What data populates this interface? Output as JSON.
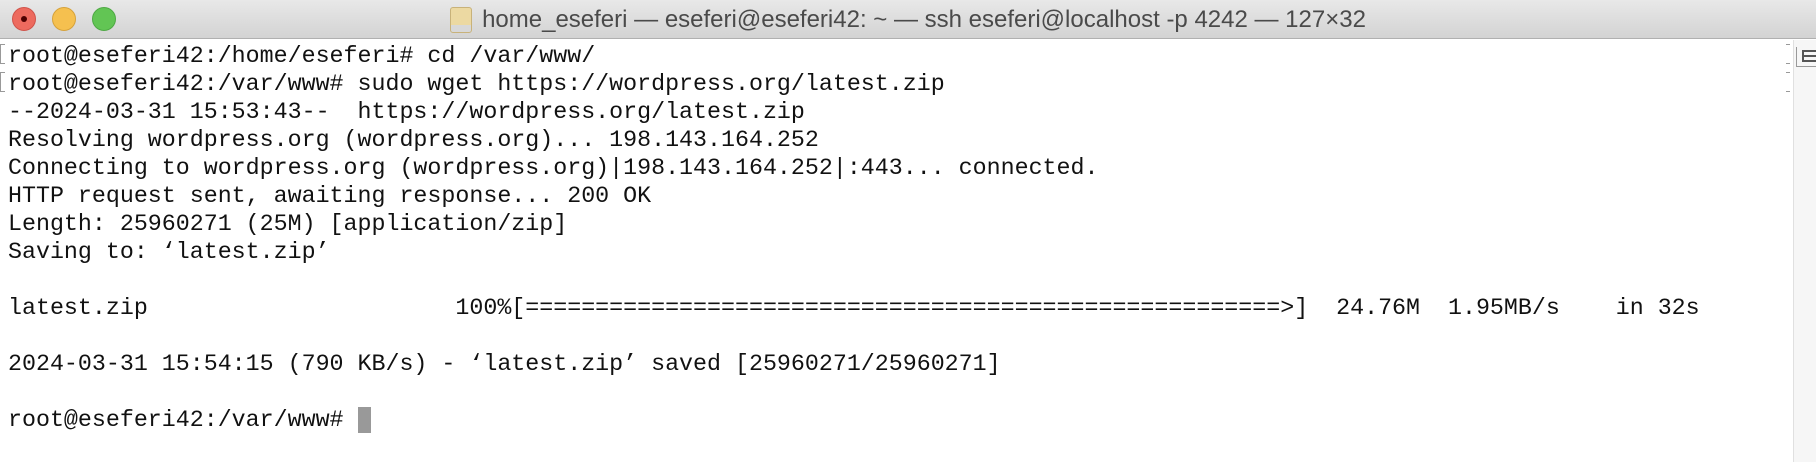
{
  "window": {
    "title": "home_eseferi — eseferi@eseferi42: ~ — ssh eseferi@localhost -p 4242 — 127×32"
  },
  "terminal": {
    "lines": [
      "root@eseferi42:/home/eseferi# cd /var/www/",
      "root@eseferi42:/var/www# sudo wget https://wordpress.org/latest.zip",
      "--2024-03-31 15:53:43--  https://wordpress.org/latest.zip",
      "Resolving wordpress.org (wordpress.org)... 198.143.164.252",
      "Connecting to wordpress.org (wordpress.org)|198.143.164.252|:443... connected.",
      "HTTP request sent, awaiting response... 200 OK",
      "Length: 25960271 (25M) [application/zip]",
      "Saving to: ‘latest.zip’",
      "",
      "latest.zip                      100%[======================================================>]  24.76M  1.95MB/s    in 32s",
      "",
      "2024-03-31 15:54:15 (790 KB/s) - ‘latest.zip’ saved [25960271/25960271]",
      "",
      "root@eseferi42:/var/www# "
    ],
    "download_progress_percent": 100
  }
}
